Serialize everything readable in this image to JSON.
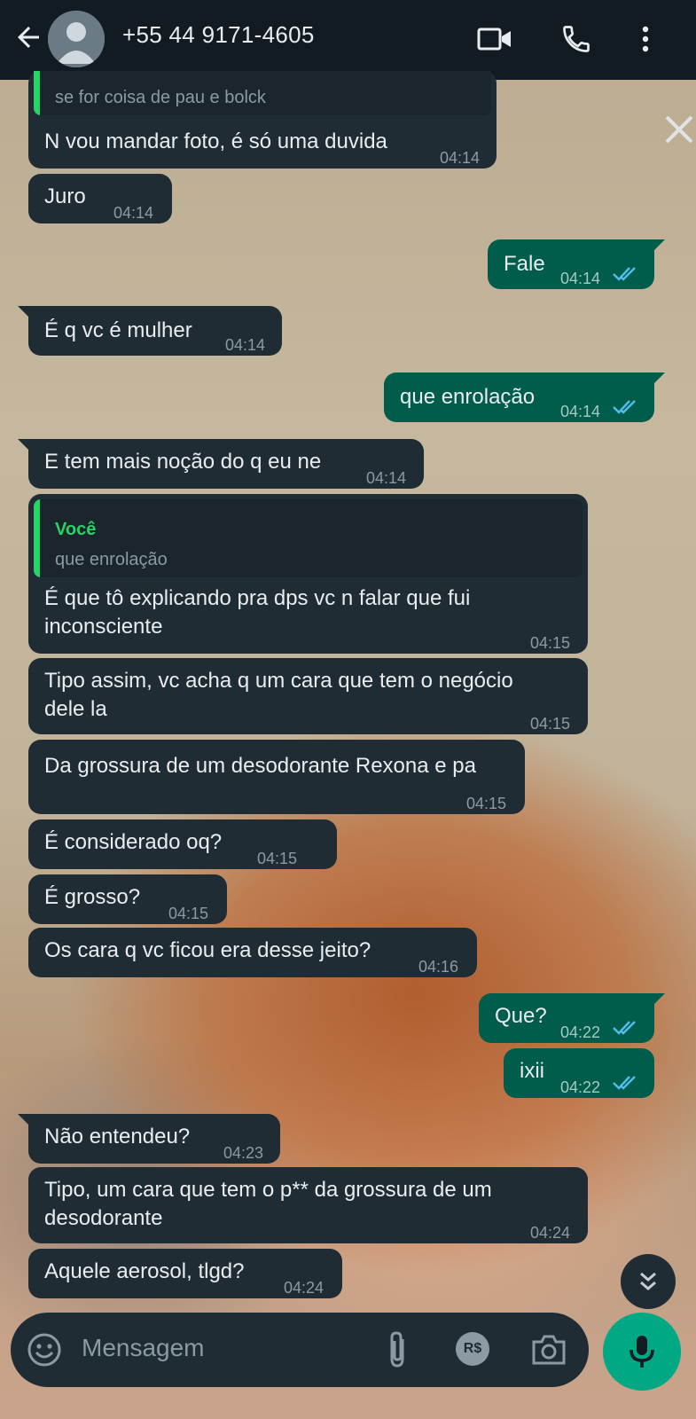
{
  "header": {
    "contact": "+55 44 9171-4605",
    "icons": [
      "back-arrow-icon",
      "avatar-icon",
      "video-call-icon",
      "phone-icon",
      "more-vert-icon"
    ]
  },
  "quoted_top": "se for coisa de pau e bolck",
  "messages": [
    {
      "dir": "in",
      "text": "N vou mandar foto, é só uma duvida",
      "time": "04:14"
    },
    {
      "dir": "in",
      "text": "Juro",
      "time": "04:14"
    },
    {
      "dir": "out",
      "text": "Fale",
      "time": "04:14"
    },
    {
      "dir": "in",
      "text": "É q vc é mulher",
      "time": "04:14"
    },
    {
      "dir": "out",
      "text": "que enrolação",
      "time": "04:14"
    },
    {
      "dir": "in",
      "text": "E tem mais noção do q eu ne",
      "time": "04:14"
    },
    {
      "dir": "in",
      "quote_author": "Você",
      "quote_text": "que enrolação",
      "text": "É que tô explicando pra dps vc n falar que fui\ninconsciente",
      "time": "04:15"
    },
    {
      "dir": "in",
      "text": "Tipo assim, vc acha q um cara que tem o negócio\ndele la",
      "time": "04:15"
    },
    {
      "dir": "in",
      "text": "Da grossura de um desodorante Rexona e pa",
      "time": "04:15"
    },
    {
      "dir": "in",
      "text": "É considerado oq?",
      "time": "04:15"
    },
    {
      "dir": "in",
      "text": "É grosso?",
      "time": "04:15"
    },
    {
      "dir": "in",
      "text": "Os cara q vc ficou era desse jeito?",
      "time": "04:16"
    },
    {
      "dir": "out",
      "text": "Que?",
      "time": "04:22"
    },
    {
      "dir": "out",
      "text": "ixii",
      "time": "04:22"
    },
    {
      "dir": "in",
      "text": "Não entendeu?",
      "time": "04:23"
    },
    {
      "dir": "in",
      "text": "Tipo, um cara que tem o p** da grossura de um\ndesodorante",
      "time": "04:24"
    },
    {
      "dir": "in",
      "text": "Aquele aerosol, tlgd?",
      "time": "04:24"
    }
  ],
  "composer": {
    "placeholder": "Mensagem",
    "icons": [
      "emoji-icon",
      "attach-icon",
      "payment-icon",
      "camera-icon",
      "mic-icon"
    ],
    "payment_label": "R$"
  },
  "colors": {
    "header": "#121b22",
    "incoming": "#1f2c34",
    "outgoing": "#005c4b",
    "accent": "#25d366",
    "read_tick": "#53bdeb"
  }
}
